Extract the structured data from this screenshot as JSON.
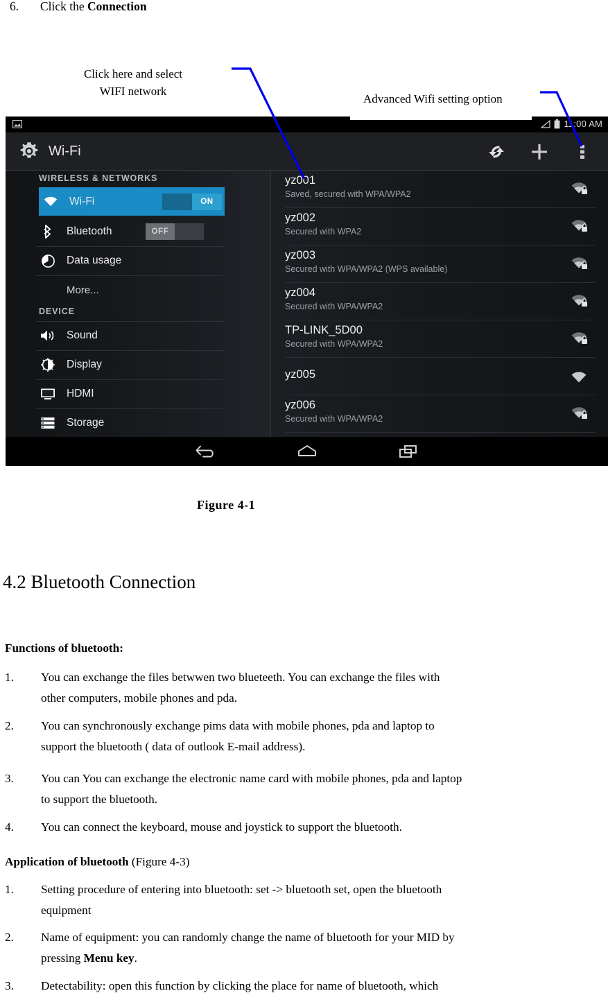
{
  "document": {
    "top_step": {
      "number": "6.",
      "text_plain": "Click the ",
      "text_bold": "Connection"
    },
    "callouts": [
      {
        "line1": "Click here and select",
        "line2": "WIFI network"
      },
      {
        "line1": "Advanced Wifi setting option"
      }
    ],
    "figure_caption": "Figure   4-1",
    "section_heading": "4.2 Bluetooth Connection",
    "functions_heading": "Functions of bluetooth:",
    "functions_list": [
      {
        "num": "1.",
        "line1": "You can exchange the files betwwen two blueteeth. You can exchange     the files with",
        "line2": "other computers, mobile phones and pda."
      },
      {
        "num": "2.",
        "line1": "You can synchronously exchange pims data with mobile phones, pda and laptop to",
        "line2": "support the bluetooth ( data of outlook E-mail address)."
      },
      {
        "num": "3.",
        "line1": "You can You can exchange the electronic name card with mobile phones, pda and laptop",
        "line2": "to support the bluetooth."
      },
      {
        "num": "4.",
        "line1": "You can connect the keyboard, mouse and joystick to support the bluetooth.",
        "line2": ""
      }
    ],
    "application_heading_bold": "Application of bluetooth",
    "application_heading_plain": " (Figure 4-3)",
    "application_list": [
      {
        "num": "1.",
        "line1": "Setting procedure of entering into bluetooth: set -> bluetooth set, open the bluetooth",
        "line2": "equipment",
        "bold_tail": ""
      },
      {
        "num": "2.",
        "line1": "Name of equipment: you can randomly change the name of bluetooth for your MID by",
        "line2": "pressing ",
        "bold_tail": "Menu key",
        "line2_end": "."
      },
      {
        "num": "3.",
        "line1": "Detectability: open this function by clicking the place for name of bluetooth, which",
        "line2": "",
        "bold_tail": ""
      }
    ],
    "annotation_color": "#0000ee"
  },
  "screenshot": {
    "status_bar": {
      "left_icon": "screenshot-icon",
      "signal_icon": "signal-triangle-icon",
      "battery_icon": "battery-icon",
      "time": "11:00 AM"
    },
    "action_bar": {
      "app_icon": "settings-gear-icon",
      "title": "Wi-Fi",
      "actions": [
        {
          "name": "wifi-scan-icon",
          "label": ""
        },
        {
          "name": "add-network-icon",
          "label": ""
        },
        {
          "name": "overflow-menu-icon",
          "label": ""
        }
      ]
    },
    "sidebar": {
      "group_wireless": "WIRELESS & NETWORKS",
      "group_device": "DEVICE",
      "items": [
        {
          "label": "Wi-Fi",
          "icon": "wifi-icon",
          "toggle": "ON",
          "toggle_state": "on",
          "active": true
        },
        {
          "label": "Bluetooth",
          "icon": "bluetooth-icon",
          "toggle": "OFF",
          "toggle_state": "off",
          "active": false
        },
        {
          "label": "Data usage",
          "icon": "data-usage-icon",
          "toggle": "",
          "toggle_state": "",
          "active": false
        },
        {
          "label": "More...",
          "icon": "",
          "toggle": "",
          "toggle_state": "",
          "active": false
        },
        {
          "label": "Sound",
          "icon": "sound-icon",
          "toggle": "",
          "toggle_state": "",
          "active": false
        },
        {
          "label": "Display",
          "icon": "display-icon",
          "toggle": "",
          "toggle_state": "",
          "active": false
        },
        {
          "label": "HDMI",
          "icon": "hdmi-icon",
          "toggle": "",
          "toggle_state": "",
          "active": false
        },
        {
          "label": "Storage",
          "icon": "storage-icon",
          "toggle": "",
          "toggle_state": "",
          "active": false
        }
      ]
    },
    "wifi_list": [
      {
        "ssid": "yz001",
        "status": "Saved, secured with WPA/WPA2",
        "signal": "wifi-signal-locked-icon",
        "bars": 3,
        "locked": true
      },
      {
        "ssid": "yz002",
        "status": "Secured with WPA2",
        "signal": "wifi-signal-locked-icon",
        "bars": 3,
        "locked": true
      },
      {
        "ssid": "yz003",
        "status": "Secured with WPA/WPA2 (WPS available)",
        "signal": "wifi-signal-locked-icon",
        "bars": 3,
        "locked": true
      },
      {
        "ssid": "yz004",
        "status": "Secured with WPA/WPA2",
        "signal": "wifi-signal-locked-icon",
        "bars": 3,
        "locked": true
      },
      {
        "ssid": "TP-LINK_5D00",
        "status": "Secured with WPA/WPA2",
        "signal": "wifi-signal-locked-icon",
        "bars": 3,
        "locked": true
      },
      {
        "ssid": "yz005",
        "status": "",
        "signal": "wifi-signal-icon",
        "bars": 3,
        "locked": false
      },
      {
        "ssid": "yz006",
        "status": "Secured with WPA/WPA2",
        "signal": "wifi-signal-locked-icon",
        "bars": 3,
        "locked": true
      }
    ],
    "nav_bar": [
      {
        "name": "back-button"
      },
      {
        "name": "home-button"
      },
      {
        "name": "recents-button"
      }
    ],
    "colors": {
      "accent_blue": "#1a8bc4",
      "toggle_on": "#2da0d0",
      "panel_dark": "#15171a",
      "status_black": "#000000"
    }
  }
}
